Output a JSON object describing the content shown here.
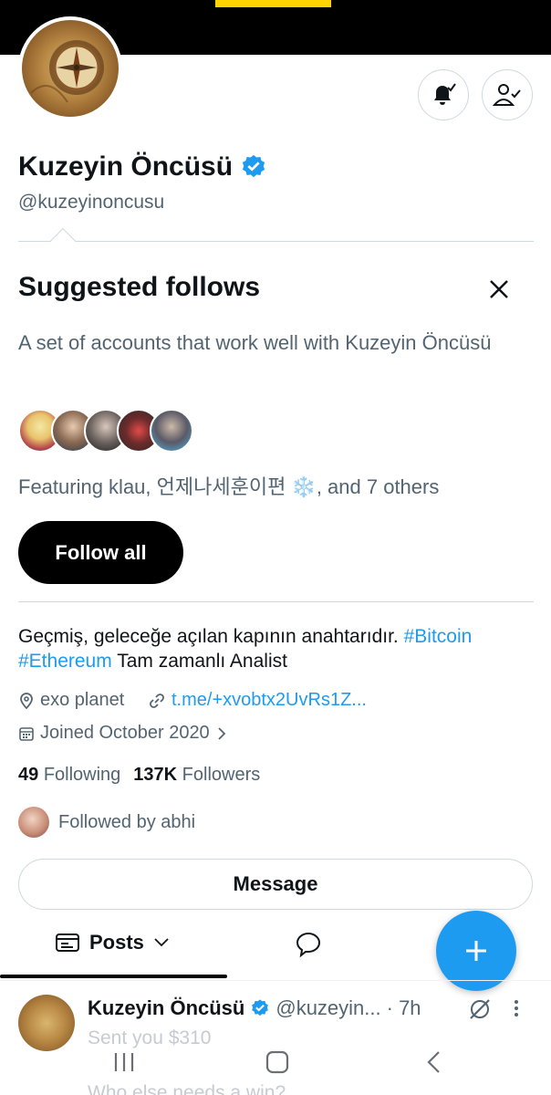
{
  "profile": {
    "display_name": "Kuzeyin Öncüsü",
    "handle": "@kuzeyinoncusu",
    "bio_text": "Geçmiş, geleceğe açılan kapının anahtarıdır.",
    "bio_tag1": "#Bitcoin",
    "bio_tag2": "#Ethereum",
    "bio_tail": "Tam zamanlı Analist",
    "location": "exo planet",
    "link": "t.me/+xvobtx2UvRs1Z...",
    "joined": "Joined October 2020",
    "following_count": "49",
    "following_label": "Following",
    "followers_count": "137K",
    "followers_label": "Followers",
    "followed_by": "Followed by abhi",
    "message_label": "Message"
  },
  "suggested": {
    "title": "Suggested follows",
    "description": "A set of accounts that work well with Kuzeyin Öncüsü",
    "featuring": "Featuring klau, 언제나세훈이편 ❄️, and 7 others",
    "follow_all_label": "Follow all"
  },
  "tabs": {
    "posts_label": "Posts"
  },
  "post": {
    "name": "Kuzeyin Öncüsü",
    "handle": "@kuzeyin...",
    "time": "· 7h",
    "text": "Sent you $310",
    "text2": "Who else needs a win?"
  },
  "colors": {
    "accent": "#1d9bf0",
    "banner": "#000000",
    "banner_accent": "#ffd400"
  }
}
